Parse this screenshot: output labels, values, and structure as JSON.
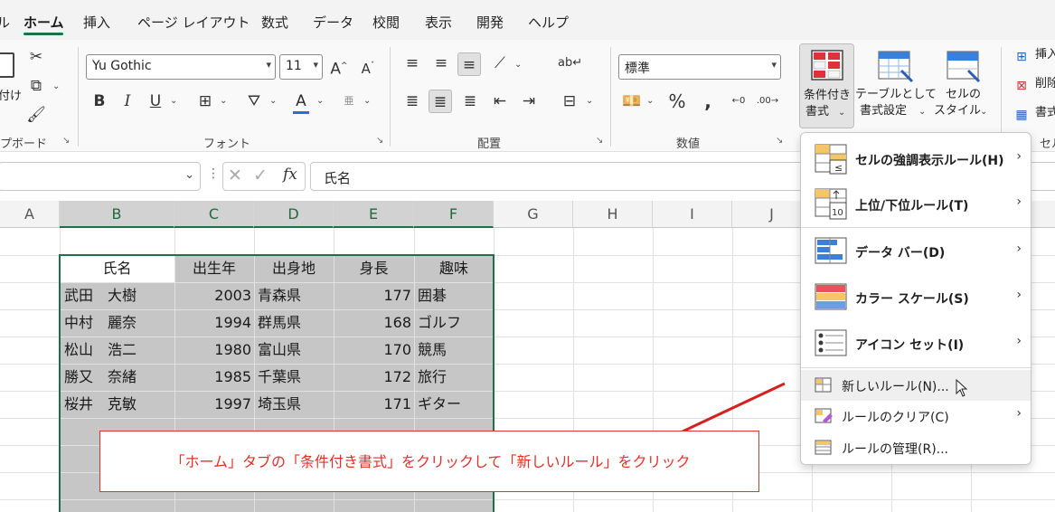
{
  "tabs": [
    {
      "label": "ホーム",
      "active": true
    },
    {
      "label": "挿入"
    },
    {
      "label": "ページ レイアウト"
    },
    {
      "label": "数式"
    },
    {
      "label": "データ"
    },
    {
      "label": "校閲"
    },
    {
      "label": "表示"
    },
    {
      "label": "開発"
    },
    {
      "label": "ヘルプ"
    }
  ],
  "ribbon": {
    "clipboard": {
      "label": "プボード",
      "paste_label": "付け"
    },
    "font": {
      "label": "フォント",
      "name": "Yu Gothic",
      "size": "11"
    },
    "alignment": {
      "label": "配置"
    },
    "number": {
      "label": "数値",
      "format": "標準"
    },
    "styles": {
      "cond_format_l1": "条件付き",
      "cond_format_l2": "書式",
      "table_format_l1": "テーブルとして",
      "table_format_l2": "書式設定",
      "cell_style_l1": "セルの",
      "cell_style_l2": "スタイル",
      "label_partial": "セル"
    },
    "cells": {
      "insert": "挿入",
      "delete": "削除",
      "format": "書式"
    }
  },
  "formula_bar": {
    "value": "氏名",
    "fx": "fx"
  },
  "columns": [
    "A",
    "B",
    "C",
    "D",
    "E",
    "F",
    "G",
    "H",
    "I",
    "J"
  ],
  "table": {
    "headers": [
      "氏名",
      "出生年",
      "出身地",
      "身長",
      "趣味"
    ],
    "rows": [
      [
        "武田　大樹",
        "2003",
        "青森県",
        "177",
        "囲碁"
      ],
      [
        "中村　麗奈",
        "1994",
        "群馬県",
        "168",
        "ゴルフ"
      ],
      [
        "松山　浩二",
        "1980",
        "富山県",
        "170",
        "競馬"
      ],
      [
        "勝又　奈緒",
        "1985",
        "千葉県",
        "172",
        "旅行"
      ],
      [
        "桜井　克敏",
        "1997",
        "埼玉県",
        "171",
        "ギター"
      ]
    ]
  },
  "menu": {
    "items": [
      {
        "label": "セルの強調表示ルール(H)",
        "icon": "highlight-rules-icon"
      },
      {
        "label": "上位/下位ルール(T)",
        "icon": "top-bottom-icon"
      },
      {
        "label": "データ バー(D)",
        "icon": "data-bar-icon"
      },
      {
        "label": "カラー スケール(S)",
        "icon": "color-scale-icon"
      },
      {
        "label": "アイコン セット(I)",
        "icon": "icon-set-icon"
      }
    ],
    "new_rule": "新しいルール(N)...",
    "clear_rule": "ルールのクリア(C)",
    "manage_rule": "ルールの管理(R)..."
  },
  "callout": "「ホーム」タブの「条件付き書式」をクリックして「新しいルール」をクリック",
  "colors": {
    "accent": "#1e7145",
    "callout_red": "#e0302a",
    "arrow_red": "#d42020"
  }
}
